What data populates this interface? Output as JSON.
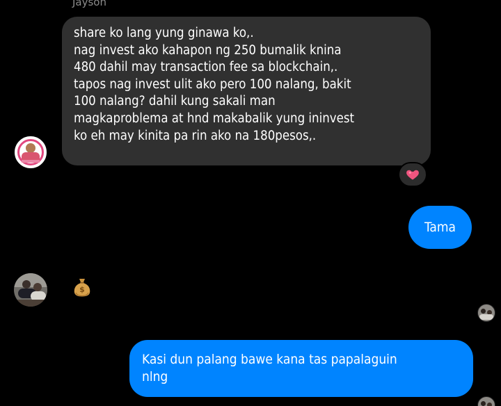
{
  "thread": {
    "sender_name": "Jayson",
    "incoming_message_lines": [
      "share ko lang yung ginawa ko,.",
      "nag invest ako kahapon ng 250 bumalik knina",
      "480 dahil may transaction fee sa blockchain,.",
      "tapos nag invest ulit ako pero 100 nalang, bakit",
      "100 nalang? dahil kung sakali man",
      "magkaproblema at hnd makabalik yung ininvest",
      "ko eh may kinita pa rin ako na 180pesos,."
    ],
    "reaction_icon": "heart-icon",
    "outgoing_1": "Tama",
    "sticker_icon": "money-bag-icon",
    "outgoing_2_lines": [
      "Kasi dun palang bawe kana tas papalaguin",
      "nlng"
    ]
  },
  "colors": {
    "background": "#000000",
    "incoming_bubble": "#303030",
    "outgoing_bubble": "#0084ff",
    "reaction_heart": "#f0557f",
    "sender_name": "#8b8b8b"
  }
}
